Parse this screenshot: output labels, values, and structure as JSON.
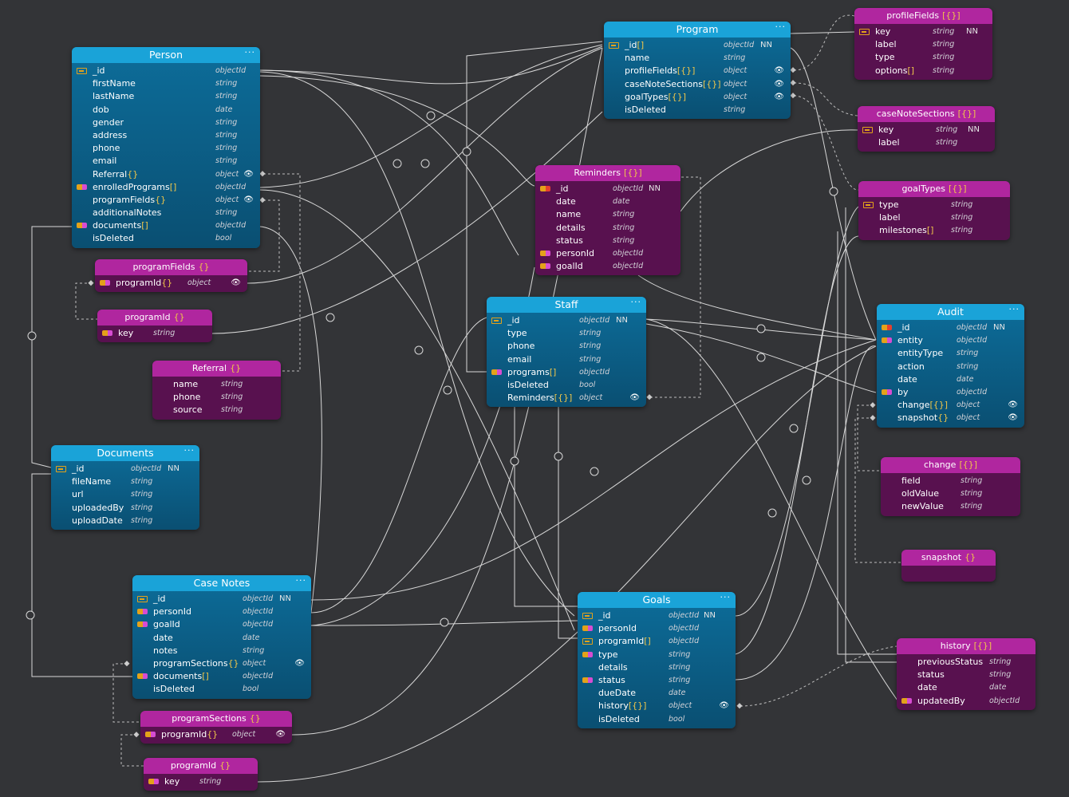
{
  "colors": {
    "blue_header": "#1aa3d8",
    "blue_body": "#0a4f72",
    "purple_header": "#b0269f",
    "purple_body": "#58114f",
    "line": "#d8d8d8",
    "canvas": "#333437"
  },
  "entities": [
    {
      "id": "person",
      "title": "Person",
      "menu": "···",
      "rows": [
        {
          "name": "_id",
          "icon": "pk",
          "type": "objectId",
          "nn": "NN"
        },
        {
          "name": "firstName",
          "type": "string"
        },
        {
          "name": "lastName",
          "type": "string"
        },
        {
          "name": "dob",
          "type": "date"
        },
        {
          "name": "gender",
          "type": "string"
        },
        {
          "name": "address",
          "type": "string"
        },
        {
          "name": "phone",
          "type": "string"
        },
        {
          "name": "email",
          "type": "string"
        },
        {
          "name": "Referral",
          "suffix": "{}",
          "type": "object",
          "eye": "👁"
        },
        {
          "name": "enrolledPrograms",
          "suffix": "[]",
          "icon": "fk",
          "type": "objectId"
        },
        {
          "name": "programFields",
          "suffix": "{}",
          "type": "object",
          "eye": "👁"
        },
        {
          "name": "additionalNotes",
          "type": "string"
        },
        {
          "name": "documents",
          "suffix": "[]",
          "icon": "fk",
          "type": "objectId"
        },
        {
          "name": "isDeleted",
          "type": "bool"
        }
      ]
    },
    {
      "id": "person_programfields",
      "title": "programFields",
      "title_suffix": "{}",
      "rows": [
        {
          "name": "programId",
          "suffix": "{}",
          "icon": "fk",
          "type": "object",
          "eye": "👁"
        }
      ]
    },
    {
      "id": "person_programid",
      "title": "programId",
      "title_suffix": "{}",
      "rows": [
        {
          "name": "key",
          "icon": "fk",
          "type": "string"
        }
      ]
    },
    {
      "id": "referral",
      "title": "Referral",
      "title_suffix": "{}",
      "rows": [
        {
          "name": "name",
          "type": "string"
        },
        {
          "name": "phone",
          "type": "string"
        },
        {
          "name": "source",
          "type": "string"
        }
      ]
    },
    {
      "id": "documents",
      "title": "Documents",
      "menu": "···",
      "rows": [
        {
          "name": "_id",
          "icon": "pk",
          "type": "objectId",
          "nn": "NN"
        },
        {
          "name": "fileName",
          "type": "string"
        },
        {
          "name": "url",
          "type": "string"
        },
        {
          "name": "uploadedBy",
          "type": "string"
        },
        {
          "name": "uploadDate",
          "type": "string"
        }
      ]
    },
    {
      "id": "casenotes",
      "title": "Case Notes",
      "menu": "···",
      "rows": [
        {
          "name": "_id",
          "icon": "pk",
          "type": "objectId",
          "nn": "NN"
        },
        {
          "name": "personId",
          "icon": "fk",
          "type": "objectId"
        },
        {
          "name": "goalId",
          "icon": "fk",
          "type": "objectId"
        },
        {
          "name": "date",
          "type": "date"
        },
        {
          "name": "notes",
          "type": "string"
        },
        {
          "name": "programSections",
          "suffix": "{}",
          "type": "object",
          "eye": "👁"
        },
        {
          "name": "documents",
          "suffix": "[]",
          "icon": "fk",
          "type": "objectId"
        },
        {
          "name": "isDeleted",
          "type": "bool"
        }
      ]
    },
    {
      "id": "programsections",
      "title": "programSections",
      "title_suffix": "{}",
      "rows": [
        {
          "name": "programId",
          "suffix": "{}",
          "icon": "fk",
          "type": "object",
          "eye": "👁"
        }
      ]
    },
    {
      "id": "cn_programid",
      "title": "programId",
      "title_suffix": "{}",
      "rows": [
        {
          "name": "key",
          "icon": "fk",
          "type": "string"
        }
      ]
    },
    {
      "id": "program",
      "title": "Program",
      "menu": "···",
      "rows": [
        {
          "name": "_id",
          "suffix": "[]",
          "icon": "pk",
          "type": "objectId",
          "nn": "NN"
        },
        {
          "name": "name",
          "type": "string"
        },
        {
          "name": "profileFields",
          "suffix": "[{}]",
          "type": "object",
          "eye": "👁"
        },
        {
          "name": "caseNoteSections",
          "suffix": "[{}]",
          "type": "object",
          "eye": "👁"
        },
        {
          "name": "goalTypes",
          "suffix": "[{}]",
          "type": "object",
          "eye": "👁"
        },
        {
          "name": "isDeleted",
          "type": "string"
        }
      ]
    },
    {
      "id": "reminders",
      "title": "Reminders",
      "title_suffix": "[{}]",
      "rows": [
        {
          "name": "_id",
          "icon": "fkr",
          "type": "objectId",
          "nn": "NN"
        },
        {
          "name": "date",
          "type": "date"
        },
        {
          "name": "name",
          "type": "string"
        },
        {
          "name": "details",
          "type": "string"
        },
        {
          "name": "status",
          "type": "string"
        },
        {
          "name": "personId",
          "icon": "fk",
          "type": "objectId"
        },
        {
          "name": "goalId",
          "icon": "fk",
          "type": "objectId"
        }
      ]
    },
    {
      "id": "staff",
      "title": "Staff",
      "menu": "···",
      "rows": [
        {
          "name": "_id",
          "icon": "pk",
          "type": "objectId",
          "nn": "NN"
        },
        {
          "name": "type",
          "type": "string"
        },
        {
          "name": "phone",
          "type": "string"
        },
        {
          "name": "email",
          "type": "string"
        },
        {
          "name": "programs",
          "suffix": "[]",
          "icon": "fk",
          "type": "objectId"
        },
        {
          "name": "isDeleted",
          "type": "bool"
        },
        {
          "name": "Reminders",
          "suffix": "[{}]",
          "type": "object",
          "eye": "👁"
        }
      ]
    },
    {
      "id": "goals",
      "title": "Goals",
      "menu": "···",
      "rows": [
        {
          "name": "_id",
          "icon": "pk",
          "type": "objectId",
          "nn": "NN"
        },
        {
          "name": "personId",
          "icon": "fk",
          "type": "objectId"
        },
        {
          "name": "programId",
          "suffix": "[]",
          "icon": "pk",
          "type": "objectId"
        },
        {
          "name": "type",
          "icon": "fk",
          "type": "string"
        },
        {
          "name": "details",
          "type": "string"
        },
        {
          "name": "status",
          "icon": "fk",
          "type": "string"
        },
        {
          "name": "dueDate",
          "type": "date"
        },
        {
          "name": "history",
          "suffix": "[{}]",
          "type": "object",
          "eye": "👁"
        },
        {
          "name": "isDeleted",
          "type": "bool"
        }
      ]
    },
    {
      "id": "profilefields",
      "title": "profileFields",
      "title_suffix": "[{}]",
      "rows": [
        {
          "name": "key",
          "icon": "pk",
          "type": "string",
          "nn": "NN"
        },
        {
          "name": "label",
          "type": "string"
        },
        {
          "name": "type",
          "type": "string"
        },
        {
          "name": "options",
          "suffix": "[]",
          "type": "string"
        }
      ]
    },
    {
      "id": "casenotesections",
      "title": "caseNoteSections",
      "title_suffix": "[{}]",
      "rows": [
        {
          "name": "key",
          "icon": "pk",
          "type": "string",
          "nn": "NN"
        },
        {
          "name": "label",
          "type": "string"
        }
      ]
    },
    {
      "id": "goaltypes",
      "title": "goalTypes",
      "title_suffix": "[{}]",
      "rows": [
        {
          "name": "type",
          "icon": "pk",
          "type": "string"
        },
        {
          "name": "label",
          "type": "string"
        },
        {
          "name": "milestones",
          "suffix": "[]",
          "type": "string"
        }
      ]
    },
    {
      "id": "audit",
      "title": "Audit",
      "menu": "···",
      "rows": [
        {
          "name": "_id",
          "icon": "fkr",
          "type": "objectId",
          "nn": "NN"
        },
        {
          "name": "entity",
          "icon": "fk",
          "type": "objectId"
        },
        {
          "name": "entityType",
          "type": "string"
        },
        {
          "name": "action",
          "type": "string"
        },
        {
          "name": "date",
          "type": "date"
        },
        {
          "name": "by",
          "icon": "fk",
          "type": "objectId"
        },
        {
          "name": "change",
          "suffix": "[{}]",
          "type": "object",
          "eye": "👁"
        },
        {
          "name": "snapshot",
          "suffix": "{}",
          "type": "object",
          "eye": "👁"
        }
      ]
    },
    {
      "id": "change",
      "title": "change",
      "title_suffix": "[{}]",
      "rows": [
        {
          "name": "field",
          "type": "string"
        },
        {
          "name": "oldValue",
          "type": "string"
        },
        {
          "name": "newValue",
          "type": "string"
        }
      ]
    },
    {
      "id": "snapshot",
      "title": "snapshot",
      "title_suffix": "{}",
      "rows": []
    },
    {
      "id": "history",
      "title": "history",
      "title_suffix": "[{}]",
      "rows": [
        {
          "name": "previousStatus",
          "type": "string"
        },
        {
          "name": "status",
          "type": "string"
        },
        {
          "name": "date",
          "type": "date"
        },
        {
          "name": "updatedBy",
          "icon": "fk",
          "type": "objectId"
        }
      ]
    }
  ]
}
